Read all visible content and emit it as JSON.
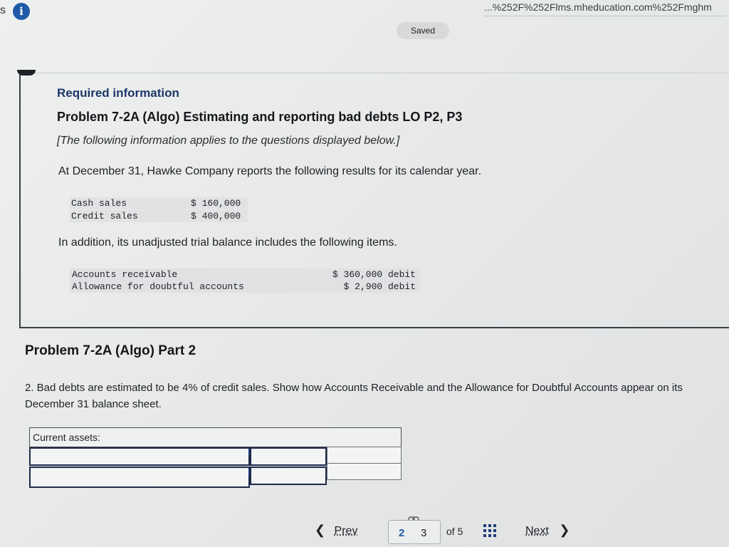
{
  "browser": {
    "url": "...%252F%252Flms.mheducation.com%252Fmghm",
    "tab_fragment": "s"
  },
  "status": {
    "saved": "Saved"
  },
  "info": {
    "required": "Required information",
    "problem_title": "Problem 7-2A (Algo) Estimating and reporting bad debts LO P2, P3",
    "note": "[The following information applies to the questions displayed below.]",
    "intro": "At December 31, Hawke Company reports the following results for its calendar year.",
    "sales": [
      {
        "label": "Cash sales",
        "value": "$ 160,000"
      },
      {
        "label": "Credit sales",
        "value": "$ 400,000"
      }
    ],
    "additional": "In addition, its unadjusted trial balance includes the following items.",
    "trial_balance": [
      {
        "label": "Accounts receivable",
        "value": "$ 360,000 debit"
      },
      {
        "label": "Allowance for doubtful accounts",
        "value": "$ 2,900 debit"
      }
    ]
  },
  "part": {
    "title": "Problem 7-2A (Algo) Part 2",
    "question": "2. Bad debts are estimated to be 4% of credit sales. Show how Accounts Receivable and the Allowance for Doubtful Accounts appear on its December 31 balance sheet."
  },
  "answer_table": {
    "header": "Current assets:",
    "rows": [
      {
        "account": "",
        "amount": "",
        "total": ""
      },
      {
        "account": "",
        "amount": "",
        "total": ""
      }
    ]
  },
  "navigation": {
    "prev": "Prev",
    "next": "Next",
    "current_page": "2",
    "next_page": "3",
    "of_total": "of 5"
  },
  "colors": {
    "accent_blue": "#1f5aa8",
    "heading_navy": "#1b3767"
  }
}
